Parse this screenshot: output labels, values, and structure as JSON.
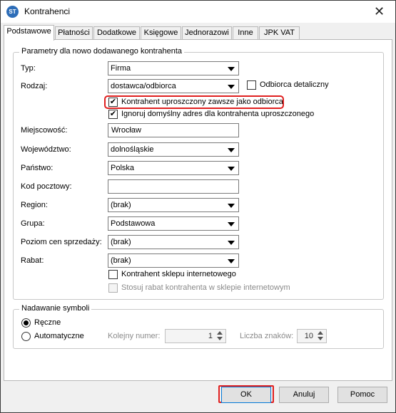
{
  "window": {
    "title": "Kontrahenci",
    "icon_text": "ST",
    "close_glyph": "✕"
  },
  "tabs": [
    {
      "label": "Podstawowe",
      "active": true
    },
    {
      "label": "Płatności"
    },
    {
      "label": "Dodatkowe"
    },
    {
      "label": "Księgowe"
    },
    {
      "label": "Jednorazowi"
    },
    {
      "label": "Inne"
    },
    {
      "label": "JPK VAT"
    }
  ],
  "params": {
    "legend": "Parametry dla nowo dodawanego kontrahenta",
    "typ": {
      "label": "Typ:",
      "value": "Firma"
    },
    "rodzaj": {
      "label": "Rodzaj:",
      "value": "dostawca/odbiorca"
    },
    "odbiorca_detaliczny": {
      "label": "Odbiorca detaliczny",
      "checked": false
    },
    "uproszczony": {
      "label": "Kontrahent uproszczony zawsze jako odbiorca",
      "checked": true
    },
    "ignoruj": {
      "label": "Ignoruj domyślny adres dla kontrahenta uproszczonego",
      "checked": true
    },
    "miejscowosc": {
      "label": "Miejscowość:",
      "value": "Wrocław"
    },
    "wojewodztwo": {
      "label": "Województwo:",
      "value": "dolnośląskie"
    },
    "panstwo": {
      "label": "Państwo:",
      "value": "Polska"
    },
    "kod": {
      "label": "Kod pocztowy:",
      "value": ""
    },
    "region": {
      "label": "Region:",
      "value": "(brak)"
    },
    "grupa": {
      "label": "Grupa:",
      "value": "Podstawowa"
    },
    "poziom": {
      "label": "Poziom cen sprzedaży:",
      "value": "(brak)"
    },
    "rabat": {
      "label": "Rabat:",
      "value": "(brak)"
    },
    "sklep": {
      "label": "Kontrahent sklepu internetowego",
      "checked": false
    },
    "stosuj": {
      "label": "Stosuj rabat kontrahenta w sklepie internetowym",
      "checked": false,
      "disabled": true
    }
  },
  "symbols": {
    "legend": "Nadawanie symboli",
    "reczne": {
      "label": "Ręczne",
      "selected": true
    },
    "auto": {
      "label": "Automatyczne",
      "selected": false
    },
    "kolejny": {
      "label": "Kolejny numer:",
      "value": "1"
    },
    "liczba": {
      "label": "Liczba znaków:",
      "value": "10"
    }
  },
  "buttons": {
    "ok": "OK",
    "anuluj": "Anuluj",
    "pomoc": "Pomoc"
  },
  "colors": {
    "highlight": "#e02020",
    "accent": "#0078d7"
  },
  "checkmark": "✔"
}
